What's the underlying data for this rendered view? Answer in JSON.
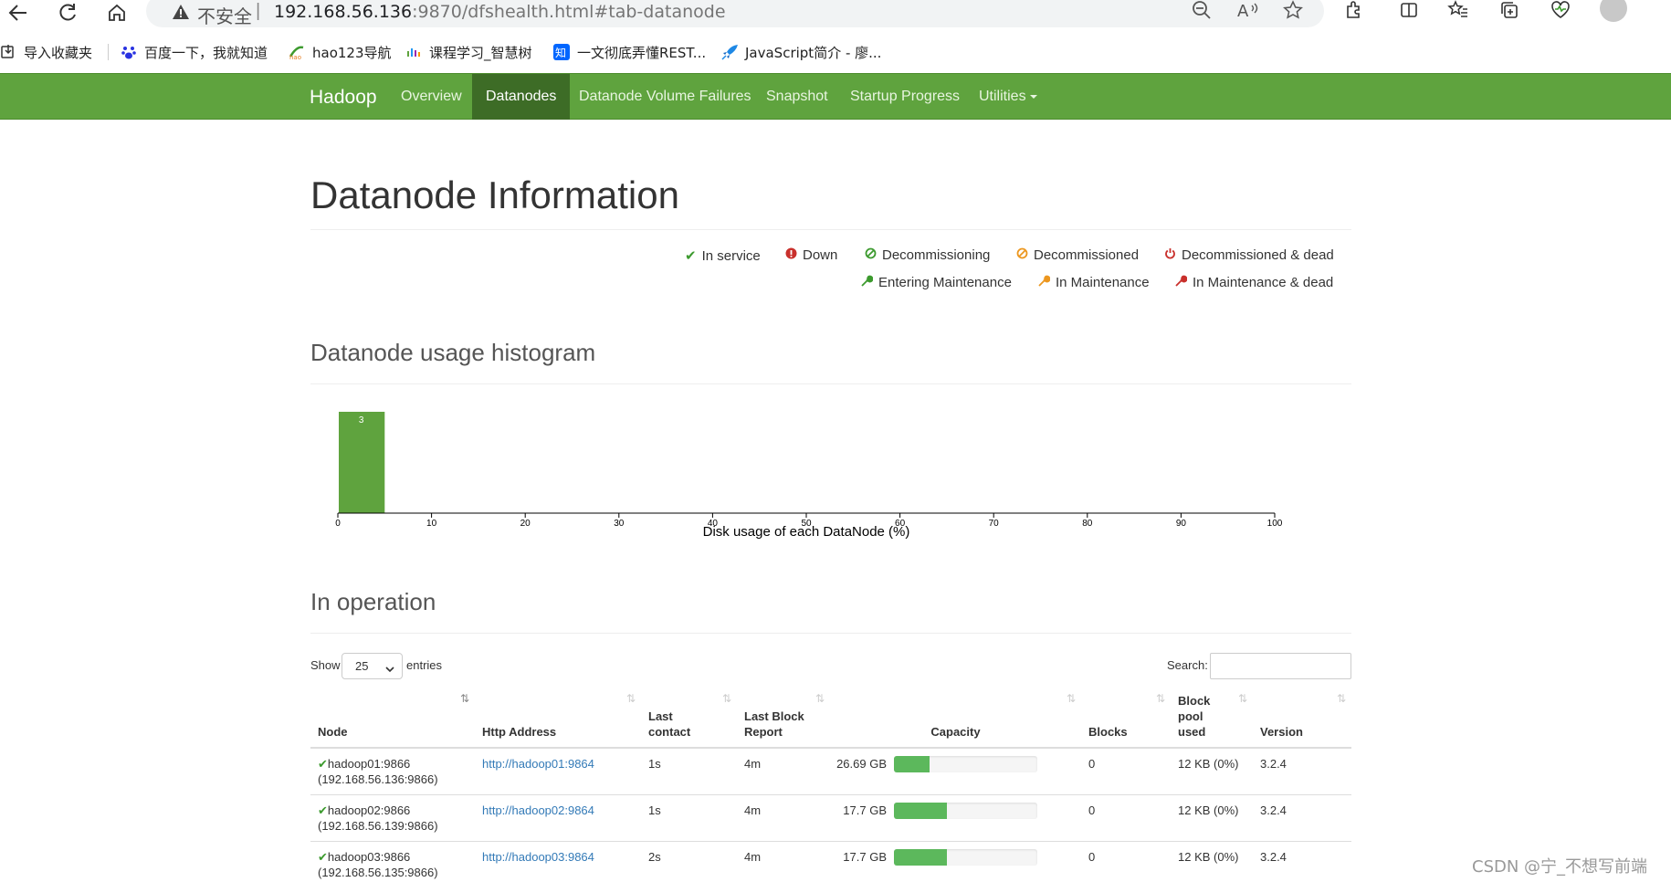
{
  "browser": {
    "insecure_label": "不安全",
    "separator": "|",
    "url_host": "192.168.56.136",
    "url_rest": ":9870/dfshealth.html#tab-datanode"
  },
  "bookmarks": [
    {
      "label": "导入收藏夹",
      "icon": "import-icon"
    },
    {
      "label": "百度一下，我就知道",
      "icon": "baidu-paw-icon"
    },
    {
      "label": "hao123导航",
      "icon": "hao123-icon"
    },
    {
      "label": "课程学习_智慧树",
      "icon": "zhihuishu-icon"
    },
    {
      "label": "一文彻底弄懂REST...",
      "icon": "zhihu-icon"
    },
    {
      "label": "JavaScript简介 - 廖...",
      "icon": "rocket-icon"
    }
  ],
  "navbar": {
    "brand": "Hadoop",
    "items": [
      {
        "label": "Overview"
      },
      {
        "label": "Datanodes",
        "active": true
      },
      {
        "label": "Datanode Volume Failures"
      },
      {
        "label": "Snapshot"
      },
      {
        "label": "Startup Progress"
      },
      {
        "label": "Utilities"
      }
    ]
  },
  "page_title": "Datanode Information",
  "legend": [
    {
      "icon": "check-icon",
      "label": "In service",
      "color": "#3c9a2e"
    },
    {
      "icon": "exclamation-icon",
      "label": "Down",
      "color": "#c9302c"
    },
    {
      "icon": "ban-icon",
      "label": "Decommissioning",
      "color": "#3c9a2e"
    },
    {
      "icon": "ban-icon",
      "label": "Decommissioned",
      "color": "#ec971f"
    },
    {
      "icon": "power-icon",
      "label": "Decommissioned & dead",
      "color": "#c9302c"
    },
    {
      "icon": "wrench-icon",
      "label": "Entering Maintenance",
      "color": "#3c9a2e"
    },
    {
      "icon": "wrench-icon",
      "label": "In Maintenance",
      "color": "#ec971f"
    },
    {
      "icon": "wrench-icon",
      "label": "In Maintenance & dead",
      "color": "#c9302c"
    }
  ],
  "histogram_title": "Datanode usage histogram",
  "chart_data": {
    "type": "bar",
    "title": "",
    "xlabel": "Disk usage of each DataNode (%)",
    "ylabel": "",
    "xlim": [
      0,
      100
    ],
    "x_ticks": [
      "0",
      "10",
      "20",
      "30",
      "40",
      "50",
      "60",
      "70",
      "80",
      "90",
      "100"
    ],
    "bins": [
      {
        "from": 0,
        "to": 5,
        "count": 3
      }
    ],
    "bar_color": "#5fa33e"
  },
  "operation_title": "In operation",
  "table_controls": {
    "show": "Show",
    "entries_value": "25",
    "entries": "entries",
    "search": "Search:"
  },
  "table": {
    "headers": [
      "Node",
      "Http Address",
      "Last contact",
      "Last Block Report",
      "Capacity",
      "Blocks",
      "Block pool used",
      "Version"
    ],
    "rows": [
      {
        "node": "hadoop01:9866",
        "ip": "(192.168.56.136:9866)",
        "http": "http://hadoop01:9864",
        "last_contact": "1s",
        "last_block_report": "4m",
        "capacity": "26.69 GB",
        "capacity_pct": 25,
        "blocks": "0",
        "bp_used": "12 KB (0%)",
        "version": "3.2.4"
      },
      {
        "node": "hadoop02:9866",
        "ip": "(192.168.56.139:9866)",
        "http": "http://hadoop02:9864",
        "last_contact": "1s",
        "last_block_report": "4m",
        "capacity": "17.7 GB",
        "capacity_pct": 37,
        "blocks": "0",
        "bp_used": "12 KB (0%)",
        "version": "3.2.4"
      },
      {
        "node": "hadoop03:9866",
        "ip": "(192.168.56.135:9866)",
        "http": "http://hadoop03:9864",
        "last_contact": "2s",
        "last_block_report": "4m",
        "capacity": "17.7 GB",
        "capacity_pct": 37,
        "blocks": "0",
        "bp_used": "12 KB (0%)",
        "version": "3.2.4"
      }
    ]
  },
  "watermark": "CSDN @宁_不想写前端"
}
